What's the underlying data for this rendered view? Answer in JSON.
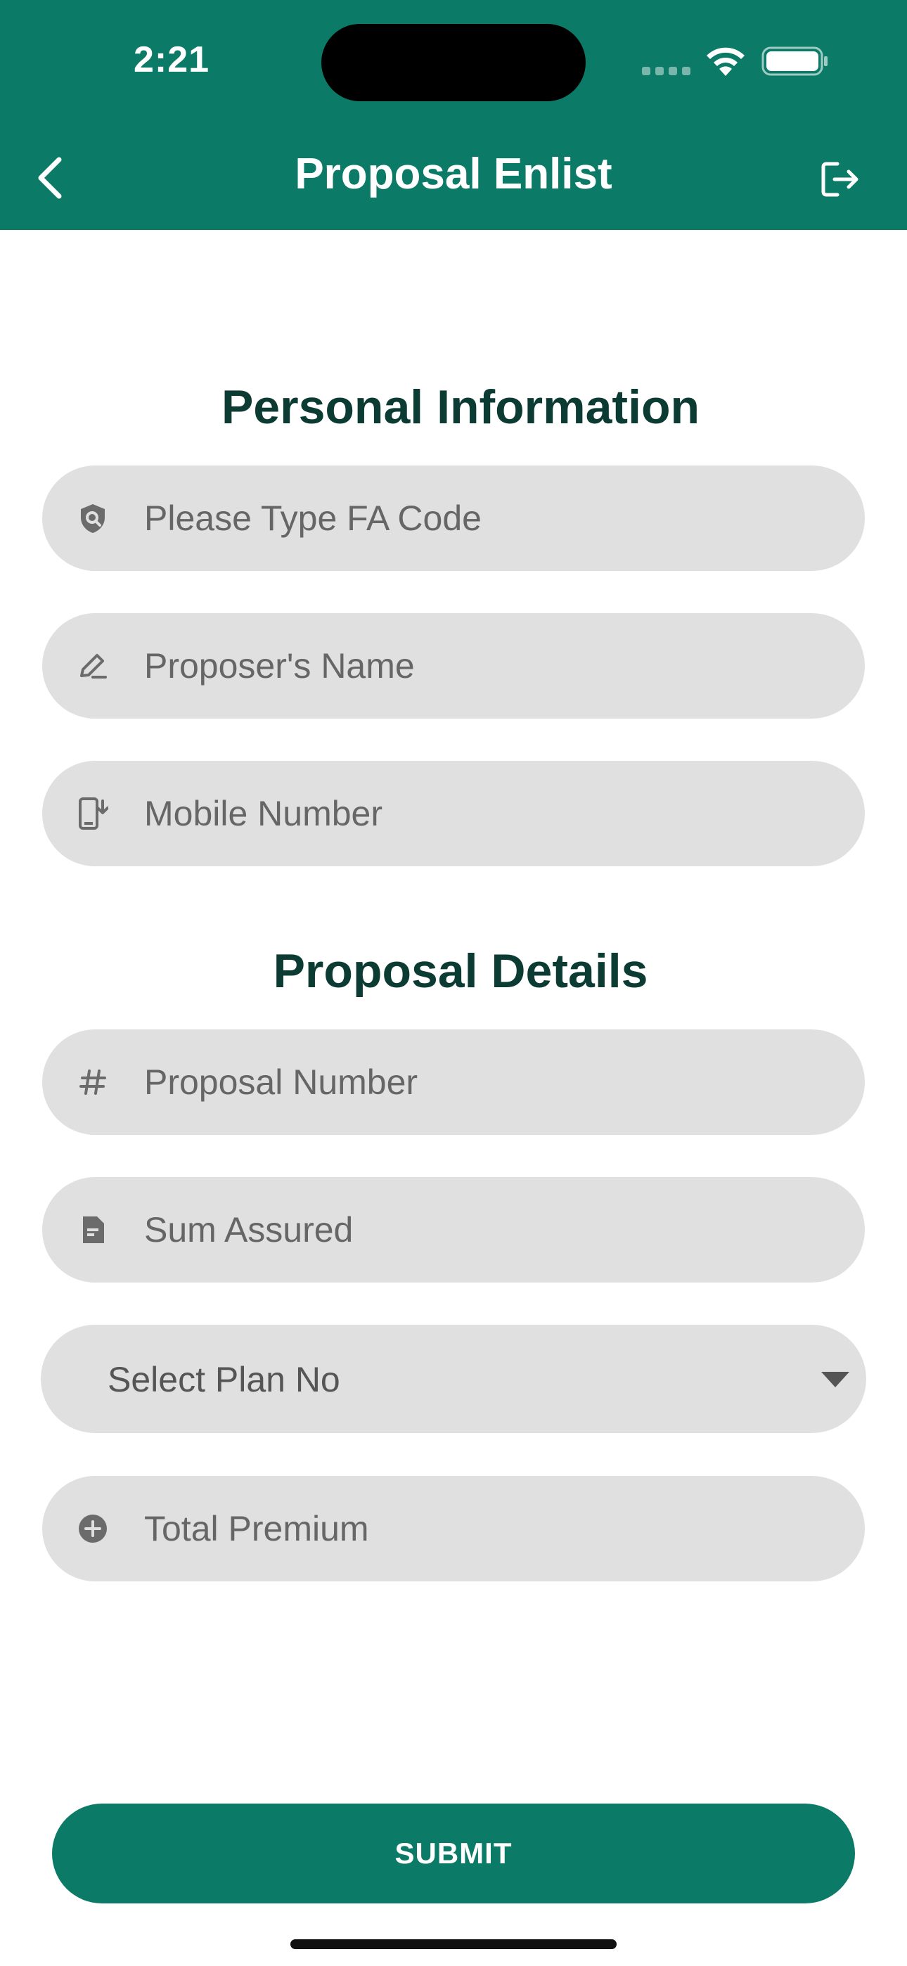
{
  "status_bar": {
    "time": "2:21"
  },
  "header": {
    "title": "Proposal Enlist",
    "back_icon": "chevron-left-icon",
    "logout_icon": "logout-icon"
  },
  "colors": {
    "primary": "#0b7a67",
    "heading": "#0c3b33",
    "field_bg": "#e0e0e0",
    "placeholder": "#666666"
  },
  "personal_information": {
    "title": "Personal Information",
    "fields": [
      {
        "icon": "shield-search-icon",
        "placeholder": "Please Type FA Code",
        "value": ""
      },
      {
        "icon": "edit-pen-icon",
        "placeholder": "Proposer's Name",
        "value": ""
      },
      {
        "icon": "mobile-download-icon",
        "placeholder": "Mobile Number",
        "value": ""
      }
    ]
  },
  "proposal_details": {
    "title": "Proposal Details",
    "fields": [
      {
        "icon": "hash-icon",
        "placeholder": "Proposal Number",
        "value": ""
      },
      {
        "icon": "document-icon",
        "placeholder": "Sum Assured",
        "value": ""
      }
    ],
    "plan_select": {
      "label": "Select Plan No",
      "icon": "caret-down-icon"
    },
    "total_premium": {
      "icon": "plus-circle-icon",
      "placeholder": "Total Premium",
      "value": ""
    }
  },
  "submit": {
    "label": "SUBMIT"
  }
}
